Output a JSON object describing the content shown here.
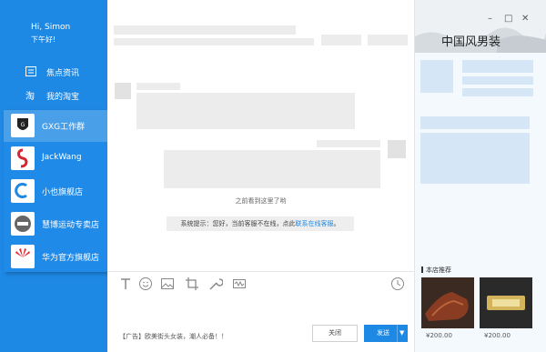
{
  "sidebar": {
    "greeting_name": "Hi, Simon",
    "greeting_sub": "下午好!",
    "nav": [
      {
        "label": "焦点资讯",
        "icon": "news-icon"
      },
      {
        "label": "我的淘宝",
        "icon": "taobao-icon"
      }
    ]
  },
  "contacts": [
    {
      "name": "GXG工作群",
      "avatar": "gxg-logo",
      "active": true
    },
    {
      "name": "JackWang",
      "avatar": "jackwang-logo",
      "active": false
    },
    {
      "name": "小也旗舰店",
      "avatar": "citycottage-logo",
      "active": false
    },
    {
      "name": "慧博运动专卖店",
      "avatar": "huibo-logo",
      "active": false
    },
    {
      "name": "华为官方旗舰店",
      "avatar": "huawei-logo",
      "active": false
    }
  ],
  "chat": {
    "separator": "之前看到这里了哟",
    "system_prefix": "系统提示：您好，当前客服不在线，点此",
    "system_link": "联系在线客服",
    "system_suffix": "。",
    "ad_text": "【广告】欧美街头女装，潮人必备！！",
    "close_label": "关闭",
    "send_label": "发送"
  },
  "toolbar_icons": [
    "text-format-icon",
    "emoji-icon",
    "image-icon",
    "crop-icon",
    "tools-icon",
    "audio-icon",
    "history-clock-icon"
  ],
  "right": {
    "brand": "中国风男装",
    "recommend_title": "本店推荐",
    "products": [
      {
        "price": "¥200.00"
      },
      {
        "price": "¥200.00"
      }
    ]
  },
  "window": {
    "minimize": "–",
    "maximize": "□",
    "close": "✕"
  },
  "colors": {
    "accent": "#1e88e5"
  }
}
